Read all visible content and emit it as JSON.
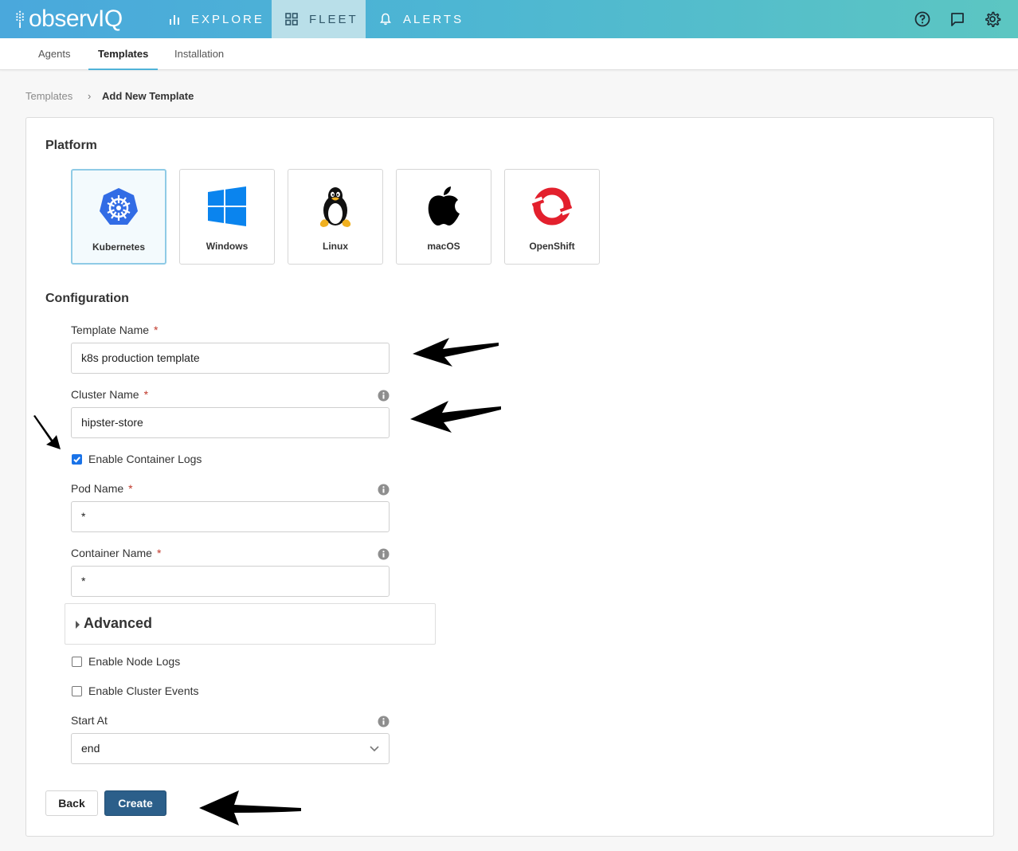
{
  "brand": {
    "name": "observIQ"
  },
  "topnav": {
    "tabs": [
      {
        "label": "EXPLORE",
        "icon": "bar-chart-icon"
      },
      {
        "label": "FLEET",
        "icon": "grid-icon"
      },
      {
        "label": "ALERTS",
        "icon": "bell-icon"
      }
    ],
    "active_tab": "FLEET",
    "right_icons": [
      "help-icon",
      "chat-icon",
      "settings-icon"
    ]
  },
  "subnav": {
    "tabs": [
      "Agents",
      "Templates",
      "Installation"
    ],
    "active": "Templates"
  },
  "breadcrumb": {
    "parent": "Templates",
    "separator": "›",
    "current": "Add New Template"
  },
  "platform": {
    "title": "Platform",
    "options": [
      {
        "label": "Kubernetes",
        "icon": "kubernetes-icon",
        "selected": true
      },
      {
        "label": "Windows",
        "icon": "windows-icon",
        "selected": false
      },
      {
        "label": "Linux",
        "icon": "linux-tux-icon",
        "selected": false
      },
      {
        "label": "macOS",
        "icon": "apple-icon",
        "selected": false
      },
      {
        "label": "OpenShift",
        "icon": "openshift-icon",
        "selected": false
      }
    ]
  },
  "configuration": {
    "title": "Configuration",
    "template_name": {
      "label": "Template Name",
      "required": "*",
      "value": "k8s production template"
    },
    "cluster_name": {
      "label": "Cluster Name",
      "required": "*",
      "value": "hipster-store"
    },
    "enable_container_logs": {
      "label": "Enable Container Logs",
      "checked": true
    },
    "pod_name": {
      "label": "Pod Name",
      "required": "*",
      "value": "*"
    },
    "container_name": {
      "label": "Container Name",
      "required": "*",
      "value": "*"
    },
    "advanced": {
      "label": "Advanced"
    },
    "enable_node_logs": {
      "label": "Enable Node Logs",
      "checked": false
    },
    "enable_cluster_events": {
      "label": "Enable Cluster Events",
      "checked": false
    },
    "start_at": {
      "label": "Start At",
      "value": "end"
    }
  },
  "actions": {
    "back_label": "Back",
    "create_label": "Create"
  },
  "colors": {
    "accent": "#4aa8dc",
    "primary_button": "#2c5f8a",
    "required": "#c0392b",
    "checkbox": "#1a73e8"
  }
}
